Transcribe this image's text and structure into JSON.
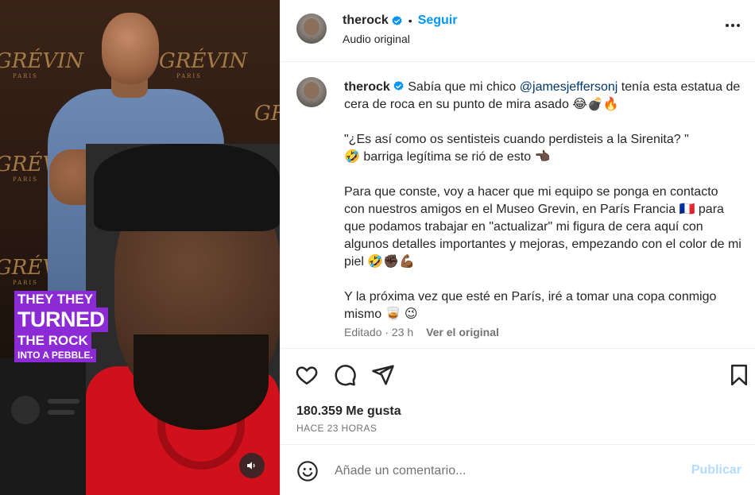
{
  "post": {
    "username": "therock",
    "follow_label": "Seguir",
    "audio": "Audio original",
    "separator": "•"
  },
  "media": {
    "brand": "GRÉVIN",
    "brand_sub": "PARIS",
    "sticker_lines": [
      "THEY THEY",
      "TURNED",
      "THE ROCK",
      "INTO A PEBBLE."
    ]
  },
  "caption": {
    "username": "therock",
    "p1_a": "Sabía que mi chico ",
    "p1_mention": "@jamesjeffersonj",
    "p1_b": " tenía esta estatua de cera de roca en su punto de mira asado 😂💣🔥",
    "p2": "\"¿Es así como os sentisteis cuando perdisteis a la Sirenita? \"",
    "p2b": "🤣 barriga legítima se rió de esto 👈🏿",
    "p3": "Para que conste, voy a hacer que mi equipo se ponga en contacto con nuestros amigos en el Museo Grevin, en París Francia 🇫🇷 para que podamos trabajar en \"actualizar\" mi figura de cera aquí con algunos detalles importantes y mejoras, empezando con el color de mi piel 🤣✊🏿💪🏾",
    "p4": "Y la próxima vez que esté en París, iré a tomar una copa conmigo mismo 🥃 😉",
    "edited": "Editado · 23 h",
    "see_original": "Ver el original"
  },
  "engagement": {
    "likes": "180.359 Me gusta",
    "time": "HACE 23 HORAS"
  },
  "comment": {
    "placeholder": "Añade un comentario...",
    "publish": "Publicar"
  },
  "colors": {
    "accent": "#0095f6",
    "sticker": "#8c2bd6",
    "publish_disabled": "#b3dbff"
  }
}
